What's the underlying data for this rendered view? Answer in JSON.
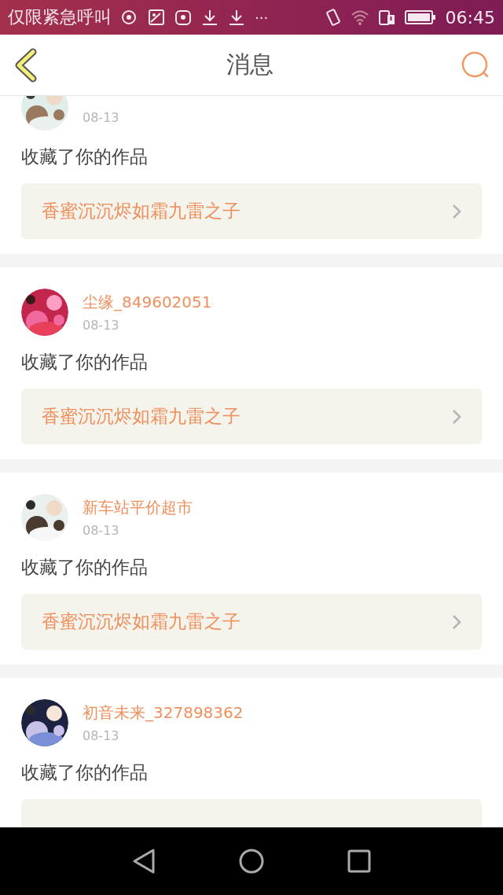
{
  "status_bar": {
    "carrier": "仅限紧急呼叫",
    "more": "···",
    "time": "06:45"
  },
  "header": {
    "title": "消息"
  },
  "messages": [
    {
      "date": "08-13",
      "action": "收藏了你的作品",
      "work": "香蜜沉沉烬如霜九雷之子"
    },
    {
      "user": "尘缘_849602051",
      "date": "08-13",
      "action": "收藏了你的作品",
      "work": "香蜜沉沉烬如霜九雷之子"
    },
    {
      "user": "新车站平价超市",
      "date": "08-13",
      "action": "收藏了你的作品",
      "work": "香蜜沉沉烬如霜九雷之子"
    },
    {
      "user": "初音未来_327898362",
      "date": "08-13",
      "action": "收藏了你的作品"
    }
  ]
}
